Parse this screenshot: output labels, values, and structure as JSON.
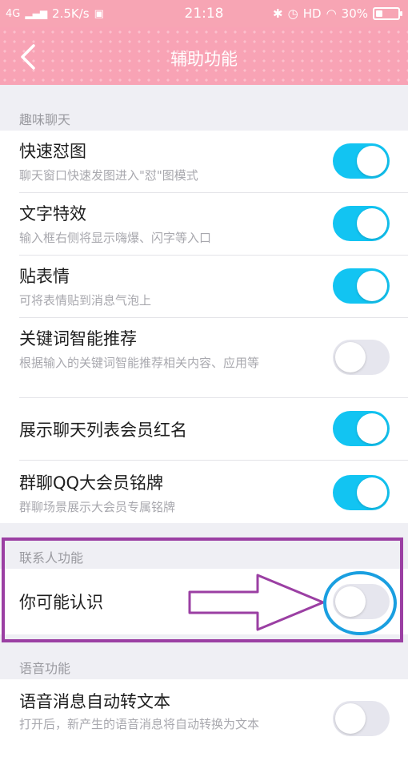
{
  "status_bar": {
    "network": "4G",
    "speed": "2.5K/s",
    "time": "21:18",
    "hd": "HD",
    "battery": "30%",
    "battery_level": 0.3
  },
  "header": {
    "title": "辅助功能"
  },
  "sections": [
    {
      "label": "趣味聊天",
      "items": [
        {
          "title": "快速怼图",
          "subtitle": "聊天窗口快速发图进入\"怼\"图模式",
          "on": true
        },
        {
          "title": "文字特效",
          "subtitle": "输入框右侧将显示嗨爆、闪字等入口",
          "on": true
        },
        {
          "title": "贴表情",
          "subtitle": "可将表情贴到消息气泡上",
          "on": true
        },
        {
          "title": "关键词智能推荐",
          "subtitle": "根据输入的关键词智能推荐相关内容、应用等",
          "on": false
        },
        {
          "title": "展示聊天列表会员红名",
          "subtitle": "",
          "on": true
        },
        {
          "title": "群聊QQ大会员铭牌",
          "subtitle": "群聊场景展示大会员专属铭牌",
          "on": true
        }
      ]
    },
    {
      "label": "联系人功能",
      "items": [
        {
          "title": "你可能认识",
          "subtitle": "",
          "on": false
        }
      ]
    },
    {
      "label": "语音功能",
      "items": [
        {
          "title": "语音消息自动转文本",
          "subtitle": "打开后，新产生的语音消息将自动转换为文本",
          "on": false
        }
      ]
    }
  ],
  "colors": {
    "toggle_on": "#12c4f2",
    "annotation": "#9b3fa3",
    "circle": "#1a9fe0"
  }
}
